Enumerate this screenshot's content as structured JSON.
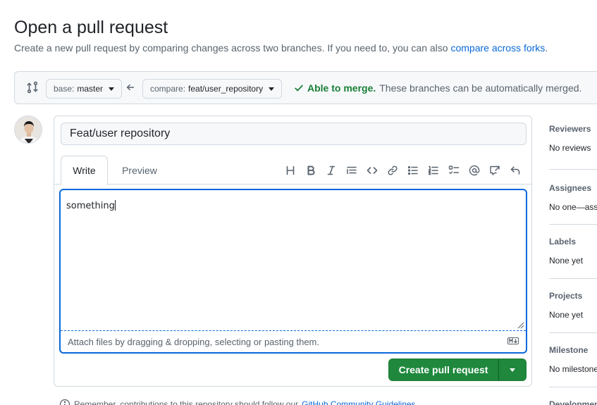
{
  "page": {
    "title": "Open a pull request",
    "subtitle": "Create a new pull request by comparing changes across two branches. If you need to, you can also",
    "subtitle_link": "compare across forks",
    "subtitle_end": "."
  },
  "range": {
    "base_prefix": "base:",
    "base_branch": "master",
    "compare_prefix": "compare:",
    "compare_branch": "feat/user_repository",
    "merge_ok": "Able to merge.",
    "merge_text": "These branches can be automatically merged."
  },
  "composer": {
    "title_value": "Feat/user repository",
    "tab_write": "Write",
    "tab_preview": "Preview",
    "body_value": "something",
    "attach_text": "Attach files by dragging & dropping, selecting or pasting them.",
    "create_label": "Create pull request",
    "toolbar_icons": [
      "heading-icon",
      "bold-icon",
      "italic-icon",
      "quote-icon",
      "code-icon",
      "link-icon",
      "unordered-list-icon",
      "ordered-list-icon",
      "task-list-icon",
      "mention-icon",
      "reference-icon",
      "undo-icon"
    ]
  },
  "sidebar": {
    "sections": [
      {
        "heading": "Reviewers",
        "value": "No reviews"
      },
      {
        "heading": "Assignees",
        "value": "No one—ass"
      },
      {
        "heading": "Labels",
        "value": "None yet"
      },
      {
        "heading": "Projects",
        "value": "None yet"
      },
      {
        "heading": "Milestone",
        "value": "No milestone"
      },
      {
        "heading": "Development",
        "value": ""
      }
    ]
  },
  "footer": {
    "note": "Remember, contributions to this repository should follow our",
    "link": "GitHub Community Guidelines"
  },
  "colors": {
    "accent": "#0969da",
    "success": "#1f883d",
    "border": "#d1d9e0"
  }
}
